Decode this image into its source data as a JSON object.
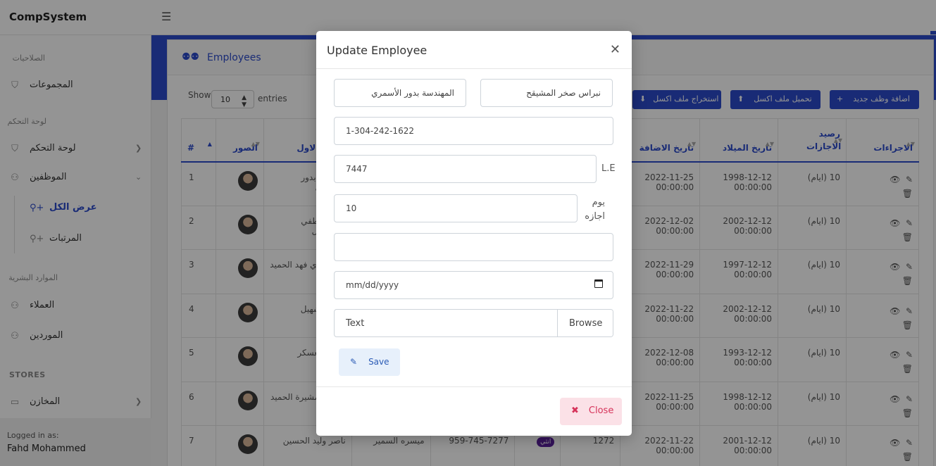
{
  "app": {
    "brand": "CompSystem"
  },
  "sidebar": {
    "sections": [
      {
        "heading": "الصلاحيات",
        "items": [
          {
            "label": "المجموعات",
            "icon": "shield-icon"
          }
        ]
      },
      {
        "heading": "لوحة التحكم",
        "items": [
          {
            "label": "لوحة التحكم",
            "icon": "shield-icon"
          },
          {
            "label": "الموظفين",
            "icon": "users-icon"
          }
        ]
      },
      {
        "heading": "الموارد البشرية",
        "items": [
          {
            "label": "العملاء",
            "icon": "users-icon"
          },
          {
            "label": "الموردين",
            "icon": "users-icon"
          }
        ]
      },
      {
        "heading": "STORES",
        "items": [
          {
            "label": "المخازن",
            "icon": "store-icon"
          }
        ]
      }
    ],
    "subitems": [
      {
        "label": "عرض الكل",
        "icon": "user-plus-icon"
      },
      {
        "label": "المرتبات",
        "icon": "user-plus-icon"
      }
    ],
    "logged_label": "Logged in as:",
    "logged_user": "Fahd Mohammed"
  },
  "page": {
    "card_title": "Employees",
    "show_label": "Show",
    "entries_value": "10",
    "entries_label": "entries",
    "buttons": {
      "add": "اضافة وظف جديد",
      "import": "تحميل ملف اكسل",
      "export": "استخراج ملف اكسل"
    }
  },
  "table": {
    "headers": {
      "num": "#",
      "photo": "الصور",
      "first_name": "الاسم الاول",
      "added_date": "تاريخ الاضافة",
      "birth_date": "تاريخ الميلاد",
      "leave_balance": "رصيد الاجازات",
      "actions": "الاجراءات"
    },
    "rows": [
      {
        "num": "1",
        "first_name": "مهندسة بدور الأسمري",
        "added": "2022-11-25 00:00:00",
        "birth": "1998-12-12 00:00:00",
        "leave": "(ايام) 10"
      },
      {
        "num": "2",
        "first_name": "ميساء لطفي السماعيل",
        "added": "2022-12-02 00:00:00",
        "birth": "2002-12-12 00:00:00",
        "leave": "(ايام) 10"
      },
      {
        "num": "3",
        "first_name": "مراد غازي فهد الحميد",
        "added": "2022-11-29 00:00:00",
        "birth": "1997-12-12 00:00:00",
        "leave": "(ايام) 10"
      },
      {
        "num": "4",
        "first_name": "حصة الشهيل",
        "added": "2022-11-22 00:00:00",
        "birth": "2002-12-12 00:00:00",
        "leave": "(ايام) 10"
      },
      {
        "num": "5",
        "first_name": "سحق العسكر",
        "added": "2022-12-08 00:00:00",
        "birth": "1993-12-12 00:00:00",
        "leave": "(ايام) 10"
      },
      {
        "num": "6",
        "first_name": "السيدة مشيرة الحميد",
        "added": "2022-11-25 00:00:00",
        "birth": "1998-12-12 00:00:00",
        "leave": "(ايام) 10"
      },
      {
        "num": "7",
        "first_name": "ناصر وليد الحسين",
        "second": "ميسره السمير",
        "phone": "959-745-7277",
        "gender": "انثي",
        "code": "1272",
        "added": "2022-11-22 00:00:00",
        "birth": "2001-12-12 00:00:00",
        "leave": "(ايام) 10"
      }
    ]
  },
  "modal": {
    "title": "Update Employee",
    "first_name": "نبراس صخر المشيقح",
    "second_name": "المهندسة بدور الأسمري",
    "phone": "1-304-242-1622",
    "salary": "7447",
    "salary_unit": "L.E",
    "leave_days": "10",
    "leave_unit": "يوم اجازه",
    "empty_field": "",
    "date_placeholder": "mm/dd/yyyy",
    "file_placeholder": "Text",
    "browse_label": "Browse",
    "save_label": "Save",
    "close_label": "Close"
  }
}
